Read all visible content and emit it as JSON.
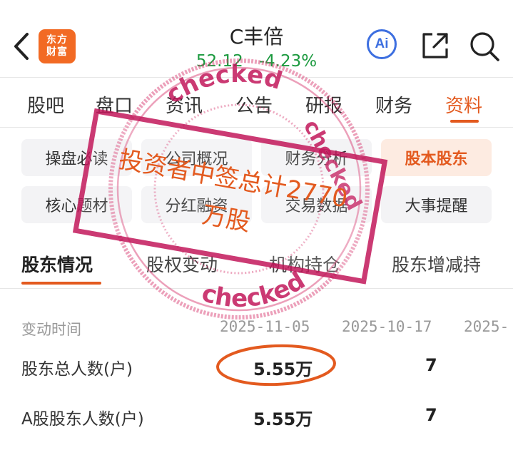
{
  "header": {
    "logo_line1": "东方",
    "logo_line2": "财富",
    "stock_name": "C丰倍",
    "price": "52.12",
    "change_pct": "-4.23%",
    "ai_label": "Ai"
  },
  "main_tabs": [
    "股吧",
    "盘口",
    "资讯",
    "公告",
    "研报",
    "财务",
    "资料"
  ],
  "sub_buttons": [
    "操盘必读",
    "公司概况",
    "财务分析",
    "股本股东",
    "核心题材",
    "分红融资",
    "交易数据",
    "大事提醒"
  ],
  "section_tabs": [
    "股东情况",
    "股权变动",
    "机构持仓",
    "股东增减持"
  ],
  "table": {
    "header_label": "变动时间",
    "dates": [
      "2025-11-05",
      "2025-10-17",
      "2025-"
    ],
    "rows": [
      {
        "label": "股东总人数(户)",
        "values": [
          "5.55万",
          "7",
          ""
        ]
      },
      {
        "label": "A股股东人数(户)",
        "values": [
          "5.55万",
          "7",
          ""
        ]
      }
    ]
  },
  "overlay": {
    "stamp_text": "checked",
    "banner_line1": "投资者中签总计2770",
    "banner_line2": "万股"
  },
  "colors": {
    "accent": "#e35a1f",
    "down_green": "#1c9a3f",
    "stamp_pink": "#d6336c",
    "logo_orange": "#f26a24"
  }
}
